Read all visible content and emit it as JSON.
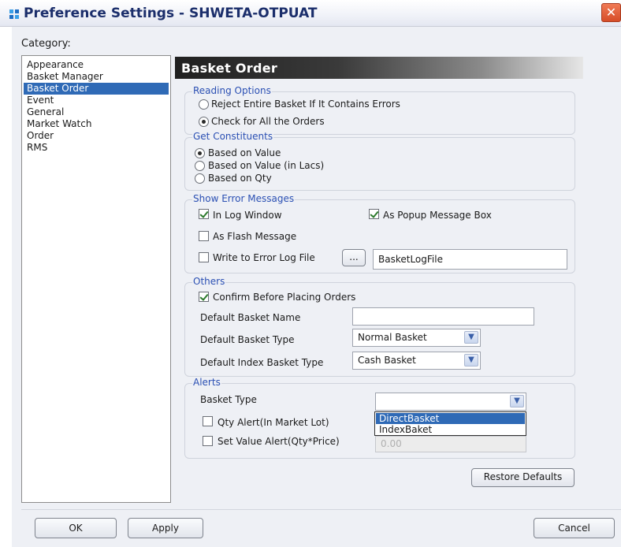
{
  "window": {
    "title": "Preference Settings - SHWETA-OTPUAT",
    "close_glyph": "✕"
  },
  "category": {
    "label": "Category:",
    "items": [
      "Appearance",
      "Basket Manager",
      "Basket Order",
      "Event",
      "General",
      "Market Watch",
      "Order",
      "RMS"
    ],
    "selected": "Basket Order"
  },
  "panel": {
    "title": "Basket Order"
  },
  "reading_options": {
    "label": "Reading Options",
    "option1": "Reject Entire Basket If It Contains Errors",
    "option2": "Check for All the Orders",
    "selected": "Check for All the Orders"
  },
  "get_constituents": {
    "label": "Get Constituents",
    "option1": "Based on Value",
    "option2": "Based on Value (in Lacs)",
    "option3": "Based on Qty",
    "selected": "Based on Value"
  },
  "show_error_messages": {
    "label": "Show Error Messages",
    "in_log_window": "In Log Window",
    "as_popup": "As Popup Message Box",
    "as_flash": "As Flash Message",
    "write_to_log": "Write to Error Log File",
    "browse_label": "...",
    "log_file_value": "BasketLogFile"
  },
  "others": {
    "label": "Others",
    "confirm_before": "Confirm Before Placing Orders",
    "default_name_label": "Default Basket Name",
    "default_name_value": "",
    "default_type_label": "Default Basket Type",
    "default_type_value": "Normal Basket",
    "default_index_label": "Default Index Basket Type",
    "default_index_value": "Cash Basket"
  },
  "alerts": {
    "label": "Alerts",
    "basket_type_label": "Basket Type",
    "basket_type_value": "",
    "qty_alert": "Qty Alert(In Market Lot)",
    "value_alert": "Set Value Alert(Qty*Price)",
    "value_alert_field": "0.00",
    "dropdown_options": [
      "DirectBasket",
      "IndexBaket"
    ],
    "dropdown_highlighted": "DirectBasket"
  },
  "buttons": {
    "restore_defaults": "Restore Defaults",
    "ok": "OK",
    "apply": "Apply",
    "cancel": "Cancel"
  },
  "colors": {
    "selection": "#2f6ab6",
    "group_label": "#2a4fb3",
    "title_text": "#1b2e6b",
    "close_button": "#d64d28"
  }
}
